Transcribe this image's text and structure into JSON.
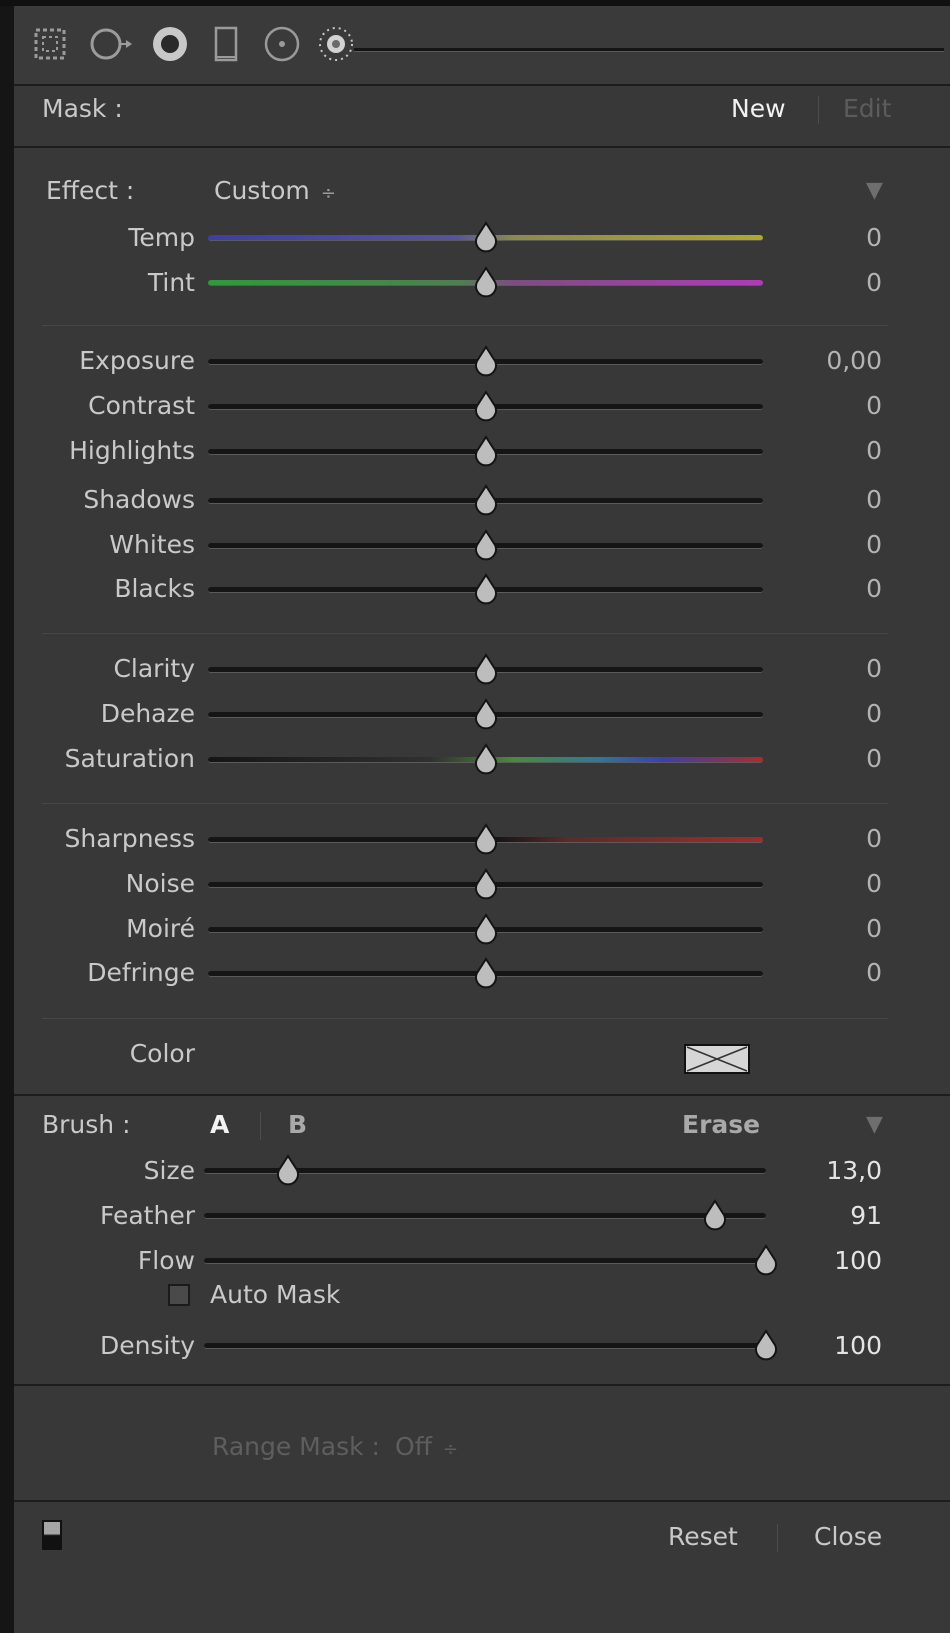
{
  "toolbar": {
    "tools": [
      "crop-overlay-icon",
      "spot-removal-icon",
      "red-eye-icon",
      "graduated-filter-icon",
      "radial-filter-icon",
      "adjustment-brush-icon"
    ]
  },
  "mask": {
    "label": "Mask :",
    "new_label": "New",
    "edit_label": "Edit"
  },
  "effect": {
    "label": "Effect :",
    "preset": "Custom",
    "preset_arrow": "÷",
    "collapse_icon": "▼"
  },
  "sliders": {
    "temp": {
      "label": "Temp",
      "value": "0",
      "position": 0.5
    },
    "tint": {
      "label": "Tint",
      "value": "0",
      "position": 0.5
    },
    "exposure": {
      "label": "Exposure",
      "value": "0,00",
      "position": 0.5
    },
    "contrast": {
      "label": "Contrast",
      "value": "0",
      "position": 0.5
    },
    "highlights": {
      "label": "Highlights",
      "value": "0",
      "position": 0.5
    },
    "shadows": {
      "label": "Shadows",
      "value": "0",
      "position": 0.5
    },
    "whites": {
      "label": "Whites",
      "value": "0",
      "position": 0.5
    },
    "blacks": {
      "label": "Blacks",
      "value": "0",
      "position": 0.5
    },
    "clarity": {
      "label": "Clarity",
      "value": "0",
      "position": 0.5
    },
    "dehaze": {
      "label": "Dehaze",
      "value": "0",
      "position": 0.5
    },
    "saturation": {
      "label": "Saturation",
      "value": "0",
      "position": 0.5
    },
    "sharpness": {
      "label": "Sharpness",
      "value": "0",
      "position": 0.5
    },
    "noise": {
      "label": "Noise",
      "value": "0",
      "position": 0.5
    },
    "moire": {
      "label": "Moiré",
      "value": "0",
      "position": 0.5
    },
    "defringe": {
      "label": "Defringe",
      "value": "0",
      "position": 0.5
    }
  },
  "color": {
    "label": "Color"
  },
  "brush": {
    "label": "Brush :",
    "a_label": "A",
    "b_label": "B",
    "erase_label": "Erase",
    "collapse_icon": "▼",
    "size": {
      "label": "Size",
      "value": "13,0",
      "position": 0.15
    },
    "feather": {
      "label": "Feather",
      "value": "91",
      "position": 0.91
    },
    "flow": {
      "label": "Flow",
      "value": "100",
      "position": 1.0
    },
    "auto_mask_label": "Auto Mask",
    "density": {
      "label": "Density",
      "value": "100",
      "position": 1.0
    }
  },
  "range_mask": {
    "label": "Range Mask :",
    "value": "Off",
    "arrow": "÷"
  },
  "footer": {
    "reset_label": "Reset",
    "close_label": "Close"
  },
  "colors": {
    "panel_bg": "#383838",
    "temp_gradient": [
      "#3b3fa0",
      "#b1a72e"
    ],
    "tint_gradient": [
      "#2f9a3a",
      "#b03bb8"
    ],
    "sharpness_red": "#a02c2c"
  }
}
